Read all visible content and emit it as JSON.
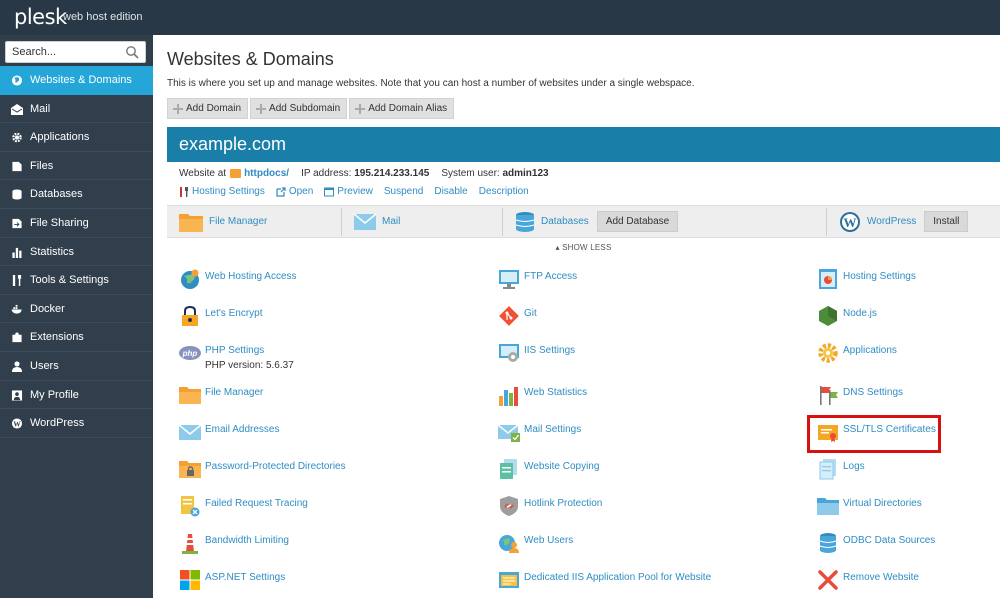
{
  "topbar": {
    "logo": "plesk",
    "edition": "web host edition"
  },
  "sidebar": {
    "search_placeholder": "Search...",
    "items": [
      {
        "label": "Websites & Domains",
        "icon": "globe-icon",
        "active": true
      },
      {
        "label": "Mail",
        "icon": "mail-icon"
      },
      {
        "label": "Applications",
        "icon": "gear-icon"
      },
      {
        "label": "Files",
        "icon": "file-icon"
      },
      {
        "label": "Databases",
        "icon": "database-icon"
      },
      {
        "label": "File Sharing",
        "icon": "file-sharing-icon"
      },
      {
        "label": "Statistics",
        "icon": "statistics-icon"
      },
      {
        "label": "Tools & Settings",
        "icon": "tools-icon"
      },
      {
        "label": "Docker",
        "icon": "docker-icon"
      },
      {
        "label": "Extensions",
        "icon": "extensions-icon"
      },
      {
        "label": "Users",
        "icon": "user-icon"
      },
      {
        "label": "My Profile",
        "icon": "profile-icon"
      },
      {
        "label": "WordPress",
        "icon": "wordpress-icon"
      }
    ]
  },
  "main": {
    "title": "Websites & Domains",
    "description": "This is where you set up and manage websites. Note that you can host a number of websites under a single webspace.",
    "toolbar": [
      "Add Domain",
      "Add Subdomain",
      "Add Domain Alias"
    ]
  },
  "domain": {
    "name": "example.com",
    "website_at_label": "Website at",
    "docroot": "httpdocs/",
    "ip_label": "IP address:",
    "ip": "195.214.233.145",
    "user_label": "System user:",
    "user": "admin123",
    "actions": [
      "Hosting Settings",
      "Open",
      "Preview",
      "Suspend",
      "Disable",
      "Description"
    ]
  },
  "quick": {
    "file_manager": "File Manager",
    "mail": "Mail",
    "databases": "Databases",
    "add_database": "Add Database",
    "wordpress": "WordPress",
    "install": "Install",
    "show_less": "SHOW LESS"
  },
  "tools": {
    "col1": [
      {
        "label": "Web Hosting Access",
        "icon": "web-hosting-access-icon"
      },
      {
        "label": "Let's Encrypt",
        "icon": "lets-encrypt-icon"
      },
      {
        "label": "PHP Settings",
        "icon": "php-icon",
        "sub": "PHP version: 5.6.37"
      },
      {
        "label": "File Manager",
        "icon": "folder-icon"
      },
      {
        "label": "Email Addresses",
        "icon": "envelope-icon"
      },
      {
        "label": "Password-Protected Directories",
        "icon": "locked-folder-icon"
      },
      {
        "label": "Failed Request Tracing",
        "icon": "request-tracing-icon"
      },
      {
        "label": "Bandwidth Limiting",
        "icon": "bandwidth-icon"
      },
      {
        "label": "ASP.NET Settings",
        "icon": "aspnet-icon"
      }
    ],
    "col2": [
      {
        "label": "FTP Access",
        "icon": "ftp-icon"
      },
      {
        "label": "Git",
        "icon": "git-icon"
      },
      {
        "label": "IIS Settings",
        "icon": "iis-icon"
      },
      {
        "label": "Web Statistics",
        "icon": "web-statistics-icon"
      },
      {
        "label": "Mail Settings",
        "icon": "mail-settings-icon"
      },
      {
        "label": "Website Copying",
        "icon": "website-copying-icon"
      },
      {
        "label": "Hotlink Protection",
        "icon": "hotlink-protection-icon"
      },
      {
        "label": "Web Users",
        "icon": "web-users-icon"
      },
      {
        "label": "Dedicated IIS Application Pool for Website",
        "icon": "app-pool-icon"
      }
    ],
    "col3": [
      {
        "label": "Hosting Settings",
        "icon": "hosting-settings-icon"
      },
      {
        "label": "Node.js",
        "icon": "nodejs-icon"
      },
      {
        "label": "Applications",
        "icon": "applications-icon"
      },
      {
        "label": "DNS Settings",
        "icon": "dns-icon"
      },
      {
        "label": "SSL/TLS Certificates",
        "icon": "certificate-icon"
      },
      {
        "label": "Logs",
        "icon": "logs-icon"
      },
      {
        "label": "Virtual Directories",
        "icon": "virtual-directories-icon"
      },
      {
        "label": "ODBC Data Sources",
        "icon": "odbc-icon"
      },
      {
        "label": "Remove Website",
        "icon": "remove-icon"
      }
    ]
  },
  "colors": {
    "topbar": "#293846",
    "sidebar": "#313f4c",
    "active": "#24a6d8",
    "domain_header": "#1a7fa8",
    "link": "#2f8dc2",
    "highlight": "#d8100e"
  }
}
